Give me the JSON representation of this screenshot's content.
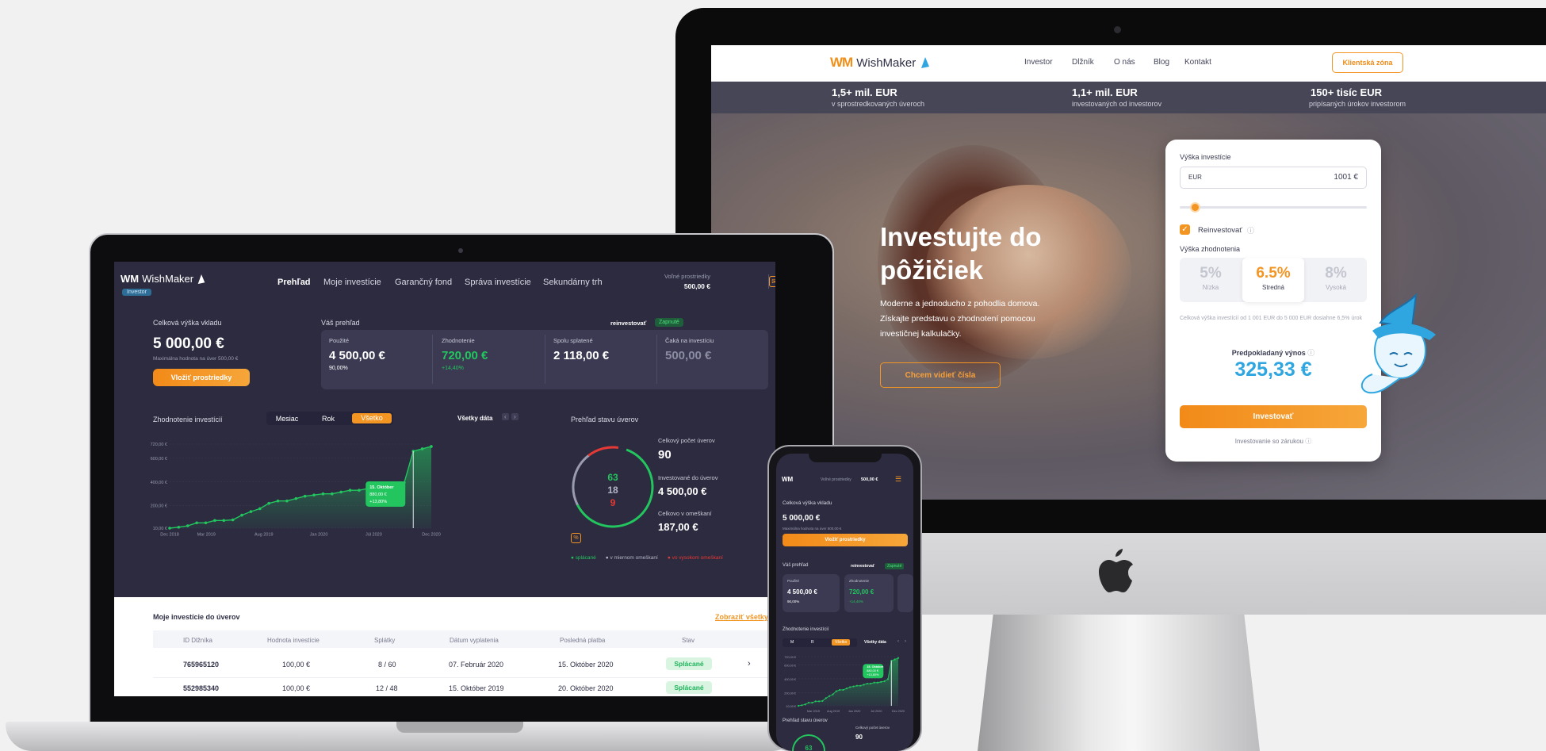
{
  "imac": {
    "brand": "WishMaker",
    "nav": [
      "Investor",
      "Dlžník",
      "O nás",
      "Blog",
      "Kontakt"
    ],
    "client_zone": "Klientská zóna",
    "stats": [
      {
        "value": "1,5+ mil. EUR",
        "label": "v sprostredkovaných úveroch"
      },
      {
        "value": "1,1+ mil. EUR",
        "label": "investovaných od investorov"
      },
      {
        "value": "150+ tisíc EUR",
        "label": "pripísaných úrokov investorom"
      }
    ],
    "hero_title": "Investujte do pôžičiek",
    "hero_sub": "Moderne a jednoducho z pohodlia domova. Získajte predstavu o zhodnotení pomocou investičnej kalkulačky.",
    "hero_button": "Chcem vidieť čísla",
    "calc": {
      "amount_label": "Výška investície",
      "currency": "EUR",
      "amount": "1001 €",
      "slider_fraction": 0.02,
      "reinvest": "Reinvestovať",
      "rate_label": "Výška zhodnotenia",
      "rates": [
        {
          "value": "5%",
          "label": "Nízka"
        },
        {
          "value": "6.5%",
          "label": "Stredná"
        },
        {
          "value": "8%",
          "label": "Vysoká"
        }
      ],
      "note": "Celková výška investícií od 1 001 EUR    do 5 000 EUR dosiahne 6,5% úrok",
      "yield_label": "Predpokladaný výnos",
      "yield": "325,33 €",
      "invest": "Investovať",
      "guarantee": "Investovanie so zárukou"
    }
  },
  "laptop": {
    "brand": "WishMaker",
    "badge": "Investor",
    "nav": [
      "Prehľad",
      "Moje investície",
      "Garančný fond",
      "Správa investície",
      "Sekundárny trh"
    ],
    "free_label": "Voľné prostriedky",
    "free_value": "500,00 €",
    "deposit_label": "Celková výška vkladu",
    "deposit_value": "5 000,00 €",
    "deposit_note": "Maximálna hodnota na úver 500,00 €",
    "deposit_button": "Vložiť prostriedky",
    "overview_label": "Váš prehľad",
    "reinvest_label": "reinvestovať",
    "reinvest_state": "Zapnuté",
    "kpis": [
      {
        "label": "Použité",
        "value": "4 500,00 €",
        "sub": "90,00%"
      },
      {
        "label": "Zhodnotenie",
        "value": "720,00 €",
        "sub": "+14,40%"
      },
      {
        "label": "Spolu splatené",
        "value": "2 118,00 €",
        "sub": ""
      },
      {
        "label": "Čaká na investíciu",
        "value": "500,00 €",
        "sub": ""
      }
    ],
    "valuation_label": "Zhodnotenie investícií",
    "periods": [
      "Mesiac",
      "Rok",
      "Všetko"
    ],
    "all_data": "Všetky dáta",
    "chart_data": {
      "type": "area",
      "x": [
        "Dec 2018",
        "Mar 2019",
        "Aug 2019",
        "Jan 2020",
        "Júl 2020",
        "Dec 2020"
      ],
      "yticks": [
        "10,00 €",
        "200,00 €",
        "400,00 €",
        "600,00 €",
        "720,00 €"
      ],
      "ylim": [
        10,
        720
      ],
      "series": [
        {
          "values": [
            10,
            18,
            30,
            55,
            55,
            75,
            75,
            80,
            120,
            150,
            175,
            220,
            240,
            240,
            260,
            280,
            290,
            300,
            300,
            315,
            330,
            330,
            345,
            345,
            355,
            365,
            395,
            660,
            680,
            700
          ]
        }
      ],
      "tooltip": [
        "15. Október",
        "880,00 €",
        "+13,80%"
      ]
    },
    "loan_state_label": "Prehľad stavu úverov",
    "donut": {
      "values": [
        "63",
        "18",
        "9"
      ]
    },
    "loan_stats": [
      {
        "label": "Celkový počet úverov",
        "value": "90"
      },
      {
        "label": "Investované do úverov",
        "value": "4 500,00 €"
      },
      {
        "label": "Celkovo v omeškaní",
        "value": "187,00 €"
      }
    ],
    "legend": [
      "splácané",
      "v miernom omeškaní",
      "vo vysokom omeškaní"
    ],
    "table_title": "Moje investície do úverov",
    "table_link": "Zobraziť všetky",
    "columns": [
      "ID Dlžníka",
      "Hodnota investície",
      "Splátky",
      "Dátum vyplatenia",
      "Posledná platba",
      "Stav"
    ],
    "rows": [
      [
        "765965120",
        "100,00 €",
        "8 / 60",
        "07. Február 2020",
        "15. Október 2020",
        "Splácané"
      ],
      [
        "552985340",
        "100,00 €",
        "12 / 48",
        "15. Október 2019",
        "20. Október 2020",
        "Splácané"
      ]
    ]
  },
  "phone": {
    "free_label": "Voľné prostriedky",
    "free_value": "500,00 €",
    "deposit_label": "Celková výška vkladu",
    "deposit_value": "5 000,00 €",
    "deposit_note": "Maximálna hodnota na úver 500,00 €",
    "deposit_button": "Vložiť prostriedky",
    "overview_label": "Váš prehľad",
    "reinvest_label": "reinvestovať",
    "reinvest_state": "Zapnuté",
    "kpi1": {
      "label": "Použité",
      "value": "4 500,00 €",
      "sub": "90,00%"
    },
    "kpi2": {
      "label": "Zhodnotenie",
      "value": "720,00 €",
      "sub": "+14,40%"
    },
    "valuation_label": "Zhodnotenie investícií",
    "periods": [
      "M",
      "R",
      "Všetko"
    ],
    "all_data": "Všetky dáta",
    "x": [
      "Mar 2019",
      "Aug 2019",
      "Jan 2020",
      "Júl 2020",
      "Dec 2020"
    ],
    "yticks": [
      "720,00 €",
      "600,00 €",
      "400,00 €",
      "200,00 €",
      "10,00 €"
    ],
    "tooltip": [
      "15. Október",
      "880,00 €",
      "+13,80%"
    ],
    "loan_state_label": "Prehľad stavu úverov",
    "donut_value": "63",
    "loan_total_label": "Celkový počet úverov",
    "loan_total": "90"
  },
  "colors": {
    "accent": "#f39523",
    "green": "#22c55e",
    "blue": "#2fa6e0",
    "dark": "#2c2b3f",
    "red": "#e53935"
  }
}
